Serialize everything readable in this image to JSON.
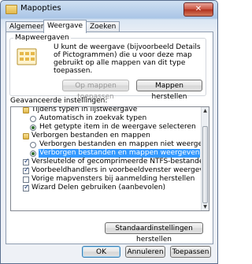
{
  "window": {
    "title": "Mapopties",
    "close_label": "✕"
  },
  "tabs": [
    "Algemeen",
    "Weergave",
    "Zoeken"
  ],
  "folder_views": {
    "group_label": "Mapweergaven",
    "description": "U kunt de weergave (bijvoorbeeld Details of Pictogrammen) die u voor deze map gebruikt op alle mappen van dit type toepassen.",
    "apply_label": "Op mappen toepassen",
    "reset_label": "Mappen herstellen"
  },
  "advanced": {
    "label": "Geavanceerde instellingen:",
    "items": [
      {
        "type": "folder",
        "label": "Tijdens typen in lijstweergave"
      },
      {
        "type": "radio",
        "checked": false,
        "label": "Automatisch in zoekvak typen"
      },
      {
        "type": "radio",
        "checked": true,
        "label": "Het getypte item in de weergave selecteren"
      },
      {
        "type": "folder",
        "label": "Verborgen bestanden en mappen"
      },
      {
        "type": "radio",
        "checked": false,
        "label": "Verborgen bestanden en mappen niet weergeven"
      },
      {
        "type": "radio",
        "checked": true,
        "selected": true,
        "label": "Verborgen bestanden en mappen weergeven"
      },
      {
        "type": "check",
        "checked": true,
        "label": "Versleutelde of gecomprimeerde NTFS-bestanden in een"
      },
      {
        "type": "check",
        "checked": true,
        "label": "Voorbeeldhandlers in voorbeeldvenster weergeven"
      },
      {
        "type": "check",
        "checked": false,
        "label": "Vorige mapvensters bij aanmelding herstellen"
      },
      {
        "type": "check",
        "checked": true,
        "label": "Wizard Delen gebruiken (aanbevolen)"
      }
    ],
    "restore_defaults_label": "Standaardinstellingen herstellen"
  },
  "buttons": {
    "ok": "OK",
    "cancel": "Annuleren",
    "apply": "Toepassen"
  },
  "colors": {
    "selection": "#3399ff",
    "title_gradient_top": "#cfe0f2",
    "close_red": "#c8503c"
  }
}
